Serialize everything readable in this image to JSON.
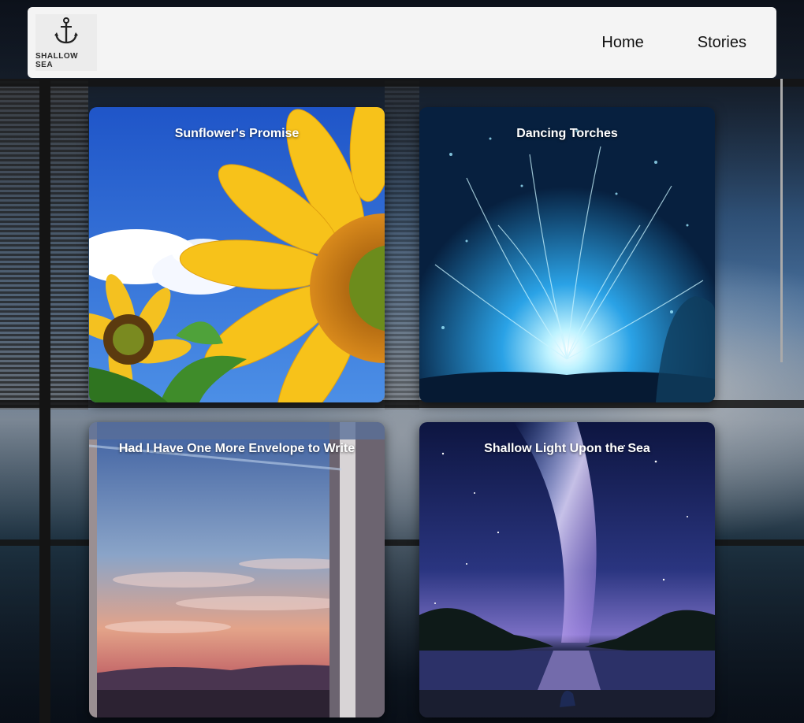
{
  "header": {
    "logo_text": "SHALLOW SEA",
    "logo_icon": "anchor-icon",
    "nav": [
      {
        "label": "Home"
      },
      {
        "label": "Stories"
      }
    ]
  },
  "stories": [
    {
      "title": "Sunflower's Promise"
    },
    {
      "title": "Dancing Torches"
    },
    {
      "title": "Had I Have One More Envelope to Write"
    },
    {
      "title": "Shallow Light Upon the Sea"
    }
  ]
}
